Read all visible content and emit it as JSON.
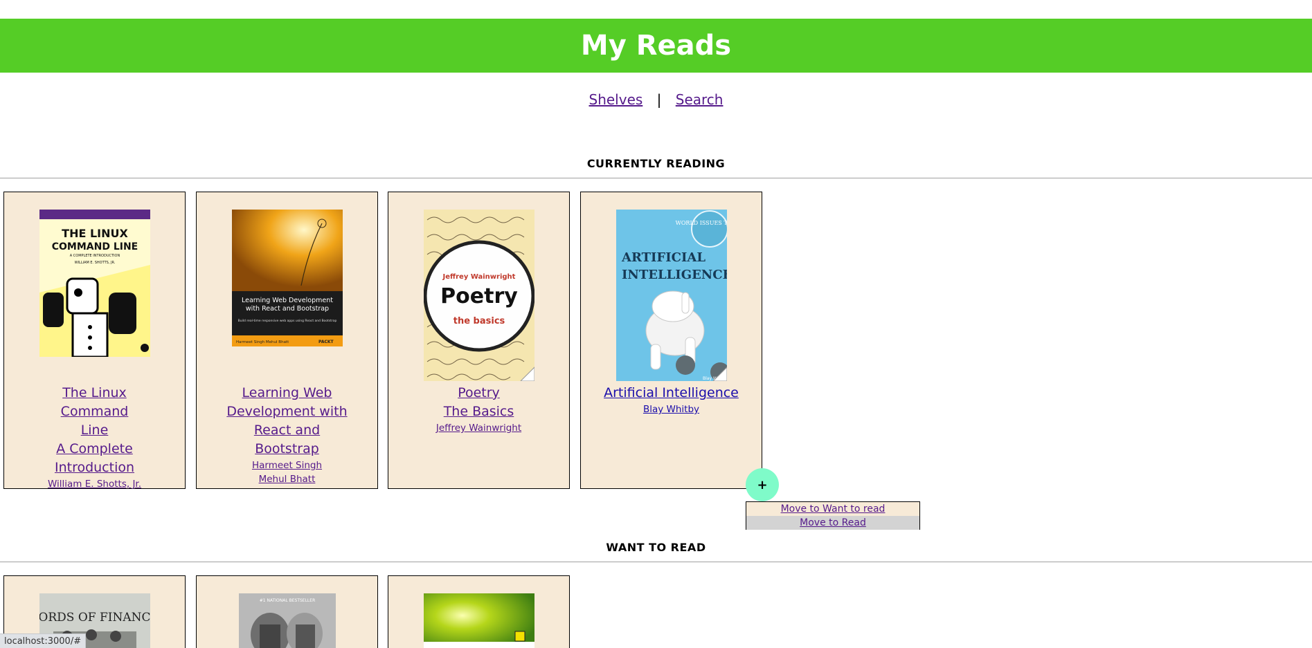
{
  "header": {
    "title": "My Reads"
  },
  "nav": {
    "shelves": "Shelves",
    "separator": "|",
    "search": "Search"
  },
  "shelves": {
    "currently_reading": {
      "title": "CURRENTLY READING",
      "books": [
        {
          "title_lines": [
            "The Linux Command",
            "Line",
            "A Complete",
            "Introduction"
          ],
          "authors": [
            "William E. Shotts, Jr."
          ],
          "cover_title": "THE LINUX COMMAND LINE",
          "cover_subtitle": "A COMPLETE INTRODUCTION",
          "cover_author": "WILLIAM E. SHOTTS, JR."
        },
        {
          "title_lines": [
            "Learning Web",
            "Development with",
            "React and Bootstrap"
          ],
          "authors": [
            "Harmeet Singh",
            "Mehul Bhatt"
          ],
          "cover_title_1": "Learning Web Development",
          "cover_title_2": "with React and Bootstrap",
          "cover_tagline": "Build real-time responsive web apps using React and Bootstrap",
          "cover_authors": "Harmeet Singh  Mehul Bhatt",
          "cover_publisher": "PACKT"
        },
        {
          "title_lines": [
            "Poetry",
            "The Basics"
          ],
          "authors": [
            "Jeffrey Wainwright"
          ],
          "cover_author": "Jeffrey Wainwright",
          "cover_title": "Poetry",
          "cover_subtitle": "the basics"
        },
        {
          "title_lines": [
            "Artificial Intelligence"
          ],
          "authors": [
            "Blay Whitby"
          ],
          "cover_title_1": "ARTIFICIAL",
          "cover_title_2": "INTELLIGENCE",
          "cover_badge": "WORLD ISSUES TODAY",
          "cover_author": "Blay Wh"
        }
      ]
    },
    "want_to_read": {
      "title": "WANT TO READ",
      "books": [
        {
          "cover_title": "LORDS OF FINANCE"
        },
        {
          "cover_caption": "#1 NATIONAL BESTSELLER"
        },
        {
          "cover_caption": ""
        }
      ]
    }
  },
  "shelf_changer": {
    "button_label": "+",
    "options": [
      "Move to Want to read",
      "Move to Read"
    ]
  },
  "status_bar": {
    "url": "localhost:3000/#"
  },
  "colors": {
    "header_bg": "#55cd26",
    "book_bg": "#f7ead7",
    "fab_bg": "#7ffbc9",
    "link_visited": "#551a8b",
    "link": "#1a0dab"
  }
}
